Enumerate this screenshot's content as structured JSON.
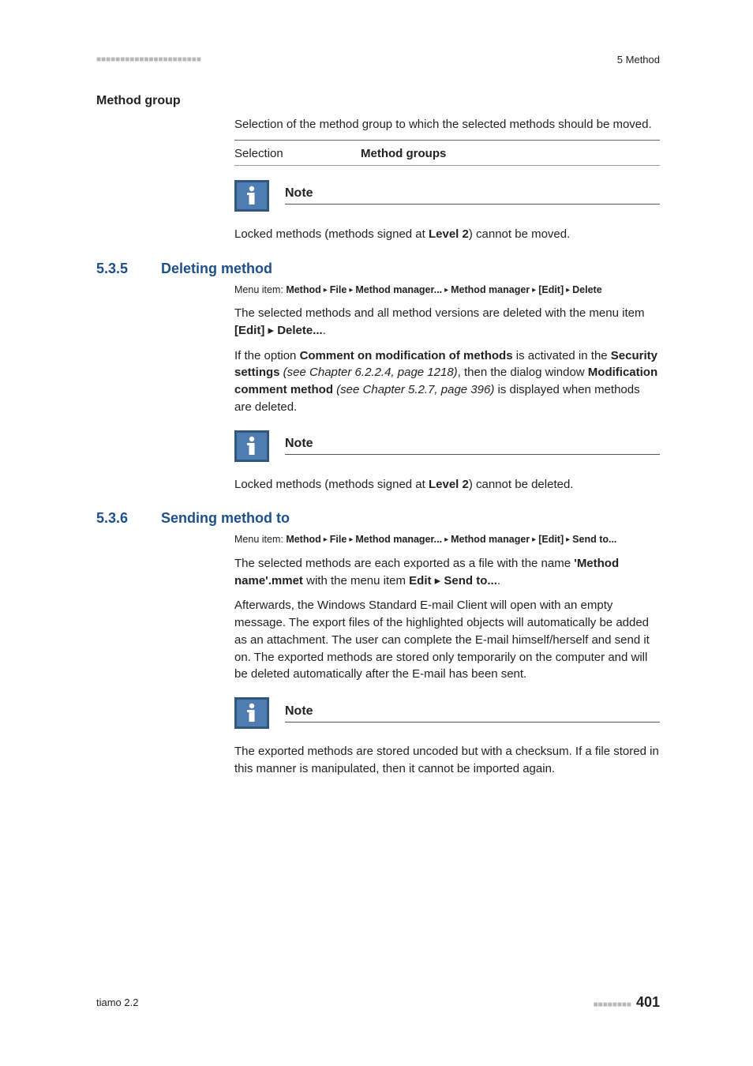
{
  "header": {
    "chapter": "5 Method"
  },
  "method_group": {
    "heading": "Method group",
    "intro": "Selection of the method group to which the selected methods should be moved.",
    "selection_label": "Selection",
    "selection_value": "Method groups",
    "note_title": "Note",
    "note_text_pre": "Locked methods (methods signed at ",
    "note_text_bold": "Level 2",
    "note_text_post": ") cannot be moved."
  },
  "sec535": {
    "num": "5.3.5",
    "title": "Deleting method",
    "menu_prefix": "Menu item: ",
    "menu_parts": [
      "Method",
      "File",
      "Method manager...",
      "Method manager",
      "[Edit]",
      "Delete"
    ],
    "p1_a": "The selected methods and all method versions are deleted with the menu item ",
    "p1_bold1": "[Edit]",
    "p1_sep": " ▸ ",
    "p1_bold2": "Delete...",
    "p1_end": ".",
    "p2_a": "If the option ",
    "p2_bold1": "Comment on modification of methods",
    "p2_b": " is activated in the ",
    "p2_bold2": "Security settings",
    "p2_ital1": " (see Chapter 6.2.2.4, page 1218)",
    "p2_c": ", then the dialog window ",
    "p2_bold3": "Modification comment method",
    "p2_ital2": " (see Chapter 5.2.7, page 396)",
    "p2_d": " is displayed when methods are deleted.",
    "note_title": "Note",
    "note_text_pre": "Locked methods (methods signed at ",
    "note_text_bold": "Level 2",
    "note_text_post": ") cannot be deleted."
  },
  "sec536": {
    "num": "5.3.6",
    "title": "Sending method to",
    "menu_prefix": "Menu item: ",
    "menu_parts": [
      "Method",
      "File",
      "Method manager...",
      "Method manager",
      "[Edit]",
      "Send to..."
    ],
    "p1_a": "The selected methods are each exported as a file with the name ",
    "p1_bold1": "'Method name'.mmet",
    "p1_b": " with the menu item ",
    "p1_bold2": "Edit",
    "p1_sep": " ▸ ",
    "p1_bold3": "Send to...",
    "p1_end": ".",
    "p2": "Afterwards, the Windows Standard E-mail Client will open with an empty message. The export files of the highlighted objects will automatically be added as an attachment. The user can complete the E-mail himself/herself and send it on. The exported methods are stored only temporarily on the computer and will be deleted automatically after the E-mail has been sent.",
    "note_title": "Note",
    "note_text": "The exported methods are stored uncoded but with a checksum. If a file stored in this manner is manipulated, then it cannot be imported again."
  },
  "footer": {
    "left": "tiamo 2.2",
    "page": "401"
  }
}
